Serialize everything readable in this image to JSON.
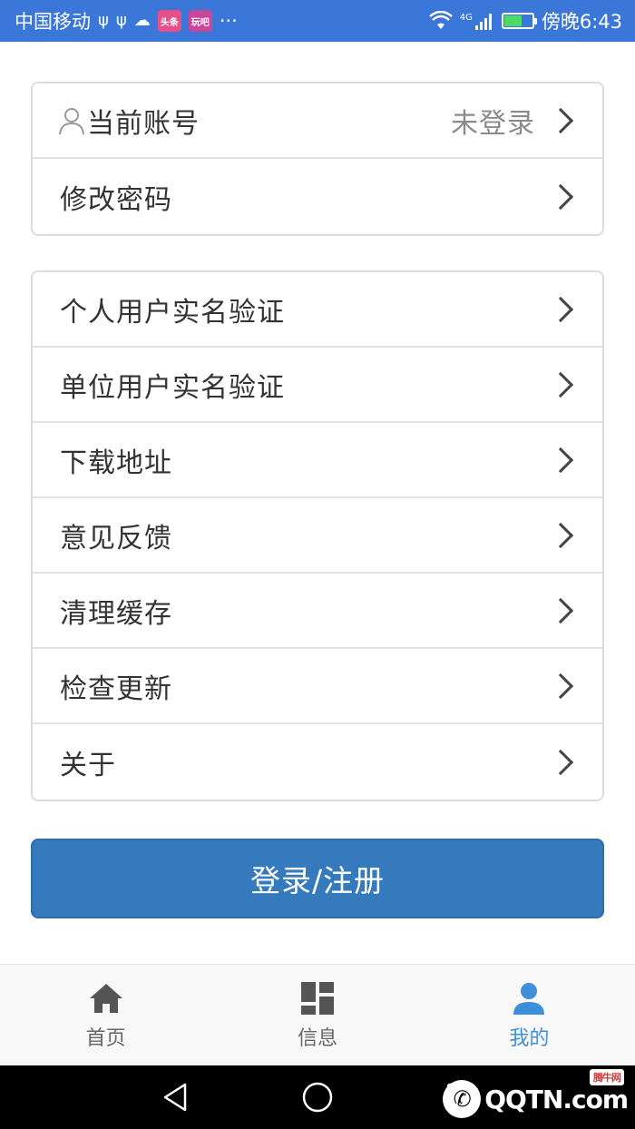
{
  "status_bar": {
    "carrier": "中国移动",
    "usb1": "ψ",
    "usb2": "ψ",
    "cloud": "☁",
    "badge1": "头条",
    "badge2": "玩吧",
    "more": "···",
    "network": "4G",
    "time": "傍晚6:43"
  },
  "account_group": {
    "items": [
      {
        "label": "当前账号",
        "value": "未登录"
      },
      {
        "label": "修改密码"
      }
    ]
  },
  "settings_group": {
    "items": [
      {
        "label": "个人用户实名验证"
      },
      {
        "label": "单位用户实名验证"
      },
      {
        "label": "下载地址"
      },
      {
        "label": "意见反馈"
      },
      {
        "label": "清理缓存"
      },
      {
        "label": "检查更新"
      },
      {
        "label": "关于"
      }
    ]
  },
  "login_button": {
    "label": "登录/注册"
  },
  "tabbar": {
    "tabs": [
      {
        "label": "首页",
        "icon": "home-icon"
      },
      {
        "label": "信息",
        "icon": "grid-icon"
      },
      {
        "label": "我的",
        "icon": "user-icon",
        "active": true
      }
    ]
  },
  "watermark": {
    "badge": "腾牛网",
    "text": "QQTN.com"
  },
  "colors": {
    "status_bar": "#3b77d9",
    "primary_button": "#357abd",
    "active_tab": "#3f8fd8"
  }
}
